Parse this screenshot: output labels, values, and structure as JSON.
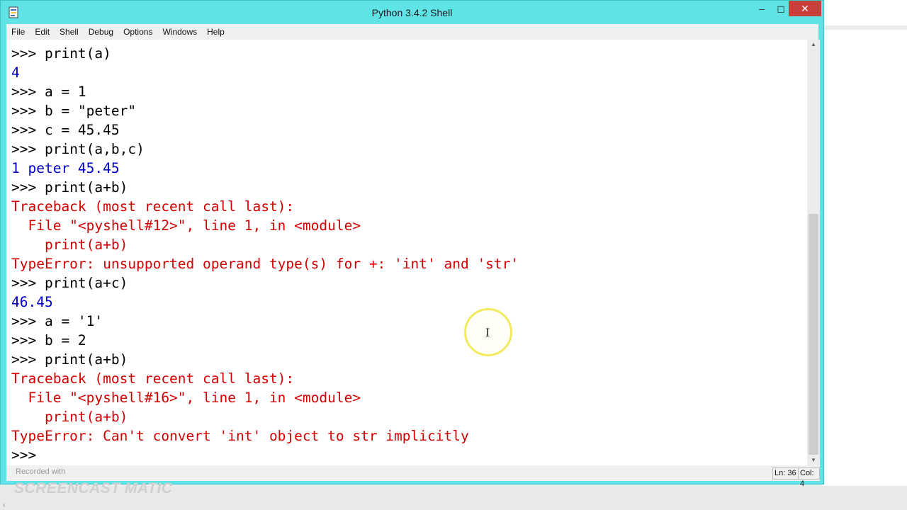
{
  "window": {
    "title": "Python 3.4.2 Shell",
    "controls": {
      "minimize": "–",
      "maximize": "◻",
      "close": "✕"
    }
  },
  "menu": [
    "File",
    "Edit",
    "Shell",
    "Debug",
    "Options",
    "Windows",
    "Help"
  ],
  "shell_lines": [
    {
      "type": "input",
      "prompt": ">>> ",
      "text": "print(a)"
    },
    {
      "type": "stdout",
      "text": "4"
    },
    {
      "type": "input",
      "prompt": ">>> ",
      "text": "a = 1"
    },
    {
      "type": "input",
      "prompt": ">>> ",
      "text": "b = \"peter\""
    },
    {
      "type": "input",
      "prompt": ">>> ",
      "text": "c = 45.45"
    },
    {
      "type": "input",
      "prompt": ">>> ",
      "text": "print(a,b,c)"
    },
    {
      "type": "stdout",
      "text": "1 peter 45.45"
    },
    {
      "type": "input",
      "prompt": ">>> ",
      "text": "print(a+b)"
    },
    {
      "type": "stderr",
      "text": "Traceback (most recent call last):"
    },
    {
      "type": "stderr",
      "text": "  File \"<pyshell#12>\", line 1, in <module>"
    },
    {
      "type": "stderr",
      "text": "    print(a+b)"
    },
    {
      "type": "stderr",
      "text": "TypeError: unsupported operand type(s) for +: 'int' and 'str'"
    },
    {
      "type": "input",
      "prompt": ">>> ",
      "text": "print(a+c)"
    },
    {
      "type": "stdout",
      "text": "46.45"
    },
    {
      "type": "input",
      "prompt": ">>> ",
      "text": "a = '1'"
    },
    {
      "type": "input",
      "prompt": ">>> ",
      "text": "b = 2"
    },
    {
      "type": "input",
      "prompt": ">>> ",
      "text": "print(a+b)"
    },
    {
      "type": "stderr",
      "text": "Traceback (most recent call last):"
    },
    {
      "type": "stderr",
      "text": "  File \"<pyshell#16>\", line 1, in <module>"
    },
    {
      "type": "stderr",
      "text": "    print(a+b)"
    },
    {
      "type": "stderr",
      "text": "TypeError: Can't convert 'int' object to str implicitly"
    },
    {
      "type": "input",
      "prompt": ">>> ",
      "text": ""
    }
  ],
  "status": {
    "ln": "Ln: 36",
    "col": "Col: 4"
  },
  "watermark": {
    "small": "Recorded with",
    "brand": "SCREENCAST  MATIC"
  },
  "colors": {
    "titlebar": "#5fe3e6",
    "stdout": "#0000c8",
    "stderr": "#d20000",
    "close": "#c9403a"
  }
}
